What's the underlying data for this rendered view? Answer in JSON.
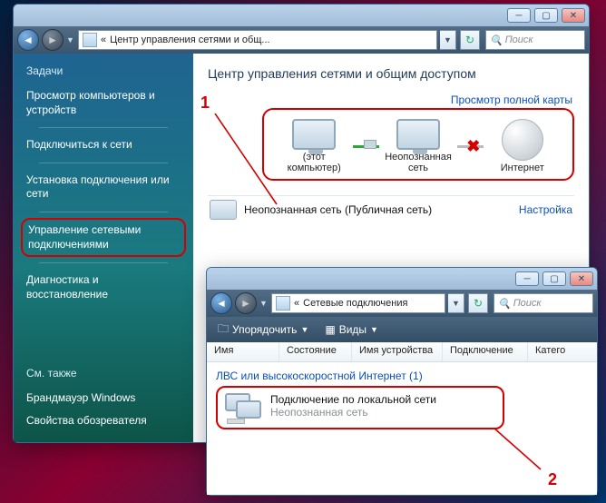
{
  "win1": {
    "address_prefix": "«",
    "address": "Центр управления сетями и общ...",
    "search_placeholder": "Поиск",
    "title": "Центр управления сетями и общим доступом",
    "map_link": "Просмотр полной карты",
    "sidebar": {
      "heading": "Задачи",
      "items": [
        "Просмотр компьютеров и устройств",
        "Подключиться к сети",
        "Установка подключения или сети",
        "Управление сетевыми подключениями",
        "Диагностика и восстановление"
      ],
      "see_heading": "См. также",
      "see_items": [
        "Брандмауэр Windows",
        "Свойства обозревателя"
      ]
    },
    "nodes": {
      "pc": "(этот компьютер)",
      "net": "Неопознанная сеть",
      "inet": "Интернет"
    },
    "status": {
      "label": "Неопознанная сеть (Публичная сеть)",
      "configure": "Настройка"
    },
    "annotation": "1"
  },
  "win2": {
    "address_prefix": "«",
    "address": "Сетевые подключения",
    "search_placeholder": "Поиск",
    "toolbar": {
      "organize": "Упорядочить",
      "views": "Виды"
    },
    "columns": [
      "Имя",
      "Состояние",
      "Имя устройства",
      "Подключение",
      "Катего"
    ],
    "group": "ЛВС или высокоскоростной Интернет (1)",
    "item": {
      "title": "Подключение по локальной сети",
      "subtitle": "Неопознанная сеть"
    },
    "annotation": "2"
  }
}
